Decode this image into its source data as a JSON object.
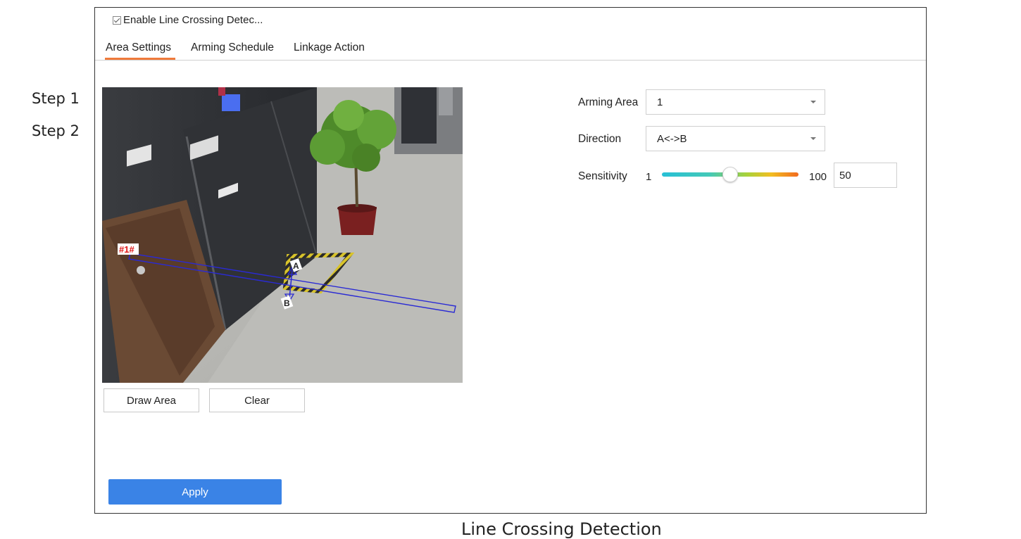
{
  "steps": {
    "step1": "Step 1",
    "step2": "Step 2"
  },
  "header": {
    "enable_label": "Enable Line Crossing Detec...",
    "enable_checked": true
  },
  "tabs": [
    {
      "label": "Area Settings",
      "active": true
    },
    {
      "label": "Arming Schedule",
      "active": false
    },
    {
      "label": "Linkage Action",
      "active": false
    }
  ],
  "video": {
    "rule_tag": "#1#",
    "direction_a": "A",
    "direction_b": "B"
  },
  "buttons": {
    "draw_area": "Draw Area",
    "clear": "Clear",
    "apply": "Apply"
  },
  "settings": {
    "arming_area_label": "Arming Area",
    "arming_area_value": "1",
    "direction_label": "Direction",
    "direction_value": "A<->B",
    "sensitivity_label": "Sensitivity",
    "sensitivity_min": "1",
    "sensitivity_max": "100",
    "sensitivity_value": "50"
  },
  "caption": "Line Crossing Detection",
  "colors": {
    "accent_tab": "#f07a3b",
    "apply_button": "#3a83e6",
    "detection_line": "#2a2ad4"
  }
}
